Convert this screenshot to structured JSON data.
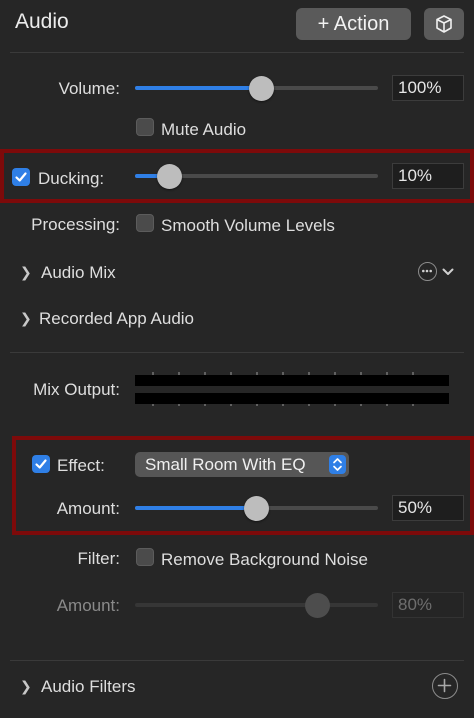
{
  "header": {
    "title": "Audio",
    "action_label": "+ Action"
  },
  "volume": {
    "label": "Volume:",
    "value_text": "100%",
    "level": 0.52
  },
  "mute": {
    "label": "Mute Audio",
    "checked": false
  },
  "ducking": {
    "label": "Ducking:",
    "checked": true,
    "value_text": "10%",
    "level": 0.14
  },
  "processing": {
    "label": "Processing:",
    "option_label": "Smooth Volume Levels",
    "checked": false
  },
  "audio_mix": {
    "label": "Audio Mix"
  },
  "recorded_app_audio": {
    "label": "Recorded App Audio"
  },
  "mix_output": {
    "label": "Mix Output:"
  },
  "effect": {
    "label": "Effect:",
    "checked": true,
    "selected": "Small Room With EQ",
    "amount_label": "Amount:",
    "amount_text": "50%",
    "level": 0.5
  },
  "filter": {
    "label": "Filter:",
    "option_label": "Remove Background Noise",
    "checked": false,
    "amount_label": "Amount:",
    "amount_text": "80%",
    "level": 0.75,
    "disabled": true
  },
  "audio_filters": {
    "label": "Audio Filters"
  },
  "colors": {
    "accent": "#2f7fe6",
    "highlight": "#7d0a0a",
    "background": "#262626"
  }
}
